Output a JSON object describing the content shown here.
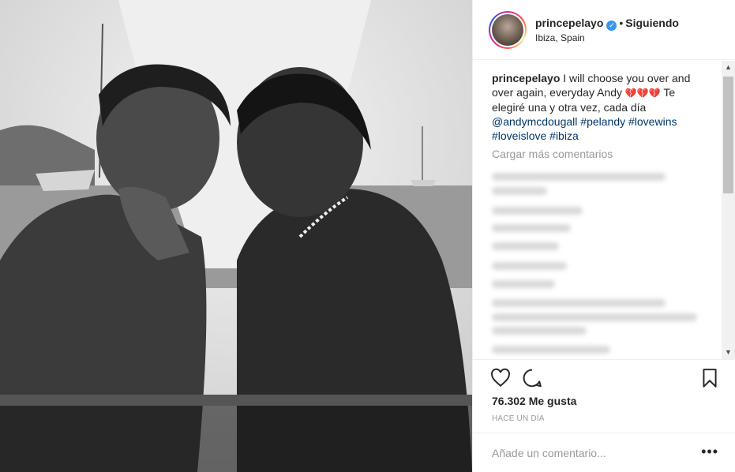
{
  "post": {
    "username": "princepelayo",
    "follow_status": "Siguiendo",
    "location": "Ibiza, Spain",
    "caption_user": "princepelayo",
    "caption_text": "I will choose you over and over again, everyday Andy",
    "caption_text_2": "Te elegiré una y otra vez, cada día",
    "hearts": "💔💔💔",
    "mention": "@andymcdougall",
    "hashtags": [
      "#pelandy",
      "#lovewins",
      "#loveislove",
      "#ibiza"
    ],
    "load_more": "Cargar más comentarios",
    "likes": "76.302 Me gusta",
    "time": "HACE UN DÍA",
    "comment_placeholder": "Añade un comentario...",
    "more_options": "•••"
  },
  "icons": {
    "verified": "verified-badge-icon",
    "like": "heart-outline-icon",
    "comment": "comment-bubble-icon",
    "save": "bookmark-icon",
    "scroll_up": "scroll-up-arrow-icon",
    "scroll_down": "scroll-down-arrow-icon"
  },
  "colors": {
    "link": "#003569",
    "verified": "#3897f0",
    "muted": "#999999",
    "text": "#262626"
  }
}
